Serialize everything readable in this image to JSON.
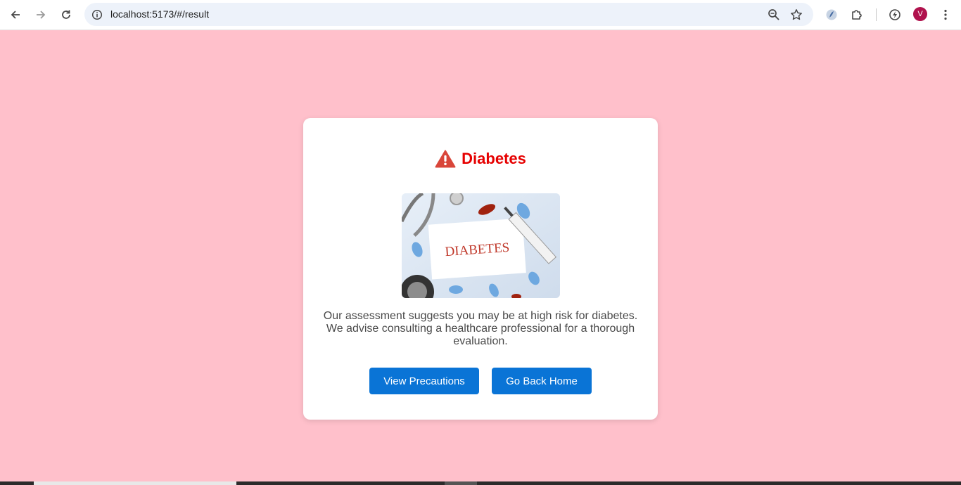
{
  "browser": {
    "url": "localhost:5173/#/result",
    "avatar_letter": "V"
  },
  "result": {
    "title": "Diabetes",
    "image_label": "DIABETES",
    "description": "Our assessment suggests you may be at high risk for diabetes. We advise consulting a healthcare professional for a thorough evaluation.",
    "buttons": {
      "precautions": "View Precautions",
      "home": "Go Back Home"
    }
  },
  "colors": {
    "page_background": "#ffc0cb",
    "title_red": "#e60000",
    "button_blue": "#0a74d6",
    "warning_icon": "#d9463a"
  },
  "icons": [
    "back-icon",
    "forward-icon",
    "reload-icon",
    "site-info-icon",
    "zoom-icon",
    "bookmark-star-icon",
    "extension-app-icon",
    "extensions-puzzle-icon",
    "performance-icon",
    "menu-dots-icon",
    "warning-icon"
  ]
}
